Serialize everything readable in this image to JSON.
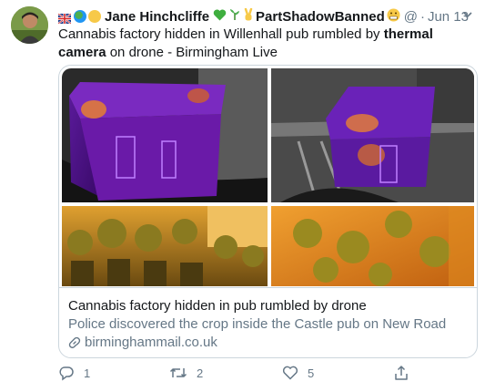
{
  "tweet": {
    "display_name": "Jane Hinchcliffe",
    "name_suffix": "PartShadowBanned",
    "handle": "@",
    "separator": "·",
    "timestamp": "Jun 13",
    "text_before": "Cannabis factory hidden in Willenhall pub rumbled by ",
    "text_bold": "thermal camera",
    "text_after": " on drone - Birmingham Live"
  },
  "card": {
    "title": "Cannabis factory hidden in pub rumbled by drone",
    "description": "Police discovered the crop inside the Castle pub on New Road",
    "domain": "birminghammail.co.uk"
  },
  "actions": {
    "replies": "1",
    "retweets": "2",
    "likes": "5"
  },
  "colors": {
    "text": "#14171a",
    "muted": "#657786",
    "border": "#ccd6dd"
  }
}
